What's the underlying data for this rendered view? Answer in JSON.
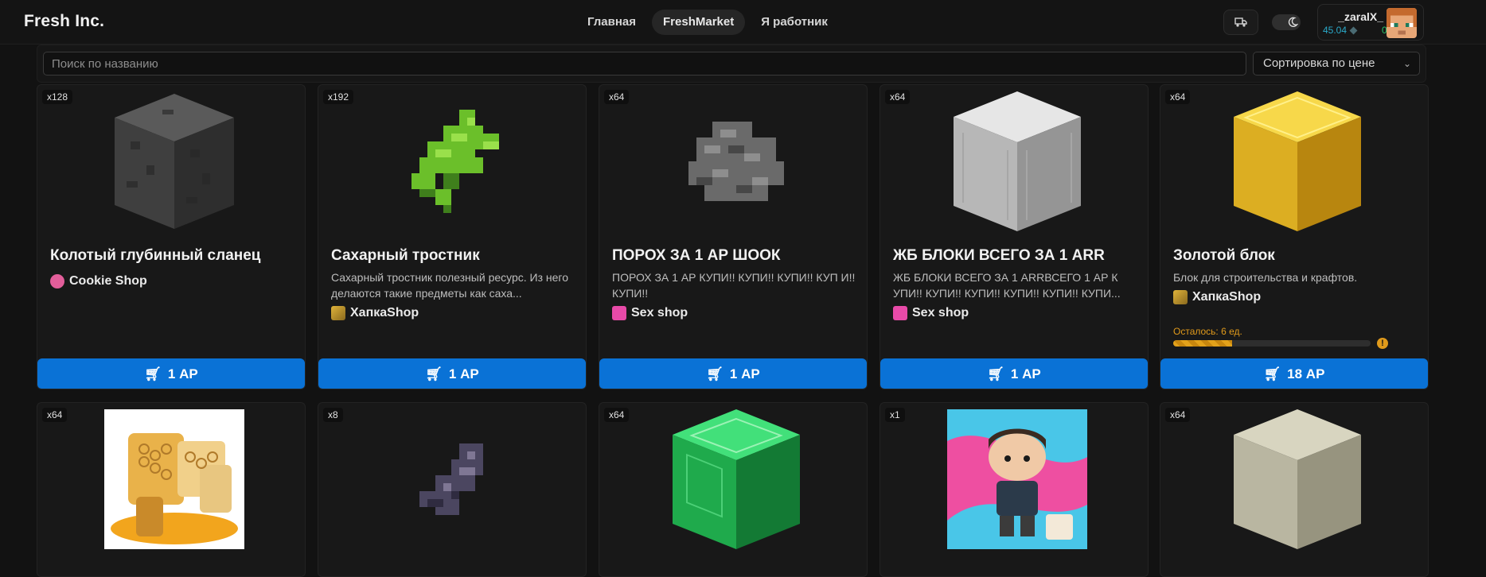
{
  "header": {
    "brand": "Fresh Inc.",
    "nav": [
      {
        "label": "Главная",
        "active": false
      },
      {
        "label": "FreshMarket",
        "active": true
      },
      {
        "label": "Я работник",
        "active": false
      }
    ],
    "icons": {
      "delivery": "truck-icon",
      "theme": "moon-icon"
    },
    "user": {
      "name": "_zaralX_",
      "balance_ar": "45.04",
      "balance_points": "0"
    }
  },
  "search": {
    "placeholder": "Поиск по названию",
    "value": ""
  },
  "sort": {
    "label": "Сортировка по цене"
  },
  "colors": {
    "accent": "#0a72d6",
    "warning": "#e09a1b",
    "background": "#121212"
  },
  "products": [
    {
      "qty": "x128",
      "title": "Колотый глубинный сланец",
      "desc": "",
      "shop": "Cookie Shop",
      "price": "1 АР"
    },
    {
      "qty": "x192",
      "title": "Сахарный тростник",
      "desc": "Сахарный тростник полезный ресурс. Из него делаются такие предметы как саха...",
      "shop": "ХапкаShop",
      "price": "1 АР"
    },
    {
      "qty": "x64",
      "title": "ПОРОХ ЗА 1 АР ШООК",
      "desc": "ПОРОХ ЗА 1 АР КУПИ!! КУПИ!! КУПИ!! КУП И!! КУПИ!!",
      "shop": "Sex shop",
      "price": "1 АР"
    },
    {
      "qty": "x64",
      "title": "ЖБ БЛОКИ ВСЕГО ЗА 1 ARR",
      "desc": "ЖБ БЛОКИ ВСЕГО ЗА 1 ARRВСЕГО 1 АР К УПИ!! КУПИ!! КУПИ!! КУПИ!! КУПИ!! КУПИ...",
      "shop": "Sex shop",
      "price": "1 АР"
    },
    {
      "qty": "x64",
      "title": "Золотой блок",
      "desc": "Блок для строительства и крафтов.",
      "shop": "ХапкаShop",
      "price": "18 АР",
      "stock_label": "Осталось: 6 ед.",
      "stock_fraction": 0.3
    },
    {
      "qty": "x64"
    },
    {
      "qty": "x8"
    },
    {
      "qty": "x64"
    },
    {
      "qty": "x1"
    },
    {
      "qty": "x64"
    }
  ]
}
